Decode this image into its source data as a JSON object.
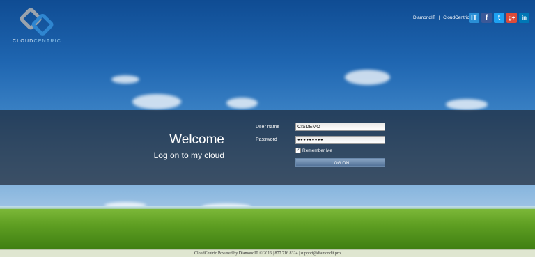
{
  "brand": {
    "logo_text_part1": "CLOUD",
    "logo_text_part2": "CENTRIC"
  },
  "header": {
    "links": [
      "DiamondIT",
      "|",
      "CloudCentric"
    ],
    "socials": [
      {
        "name": "it",
        "glyph": "IT",
        "color": "#2a8fd6"
      },
      {
        "name": "facebook",
        "glyph": "f",
        "color": "#3b5998"
      },
      {
        "name": "twitter",
        "glyph": "t",
        "color": "#1da1f2"
      },
      {
        "name": "google-plus",
        "glyph": "g+",
        "color": "#dd4b39"
      },
      {
        "name": "linkedin",
        "glyph": "in",
        "color": "#0077b5"
      }
    ]
  },
  "welcome": {
    "title": "Welcome",
    "subtitle": "Log on to my cloud"
  },
  "login": {
    "username_label": "User name",
    "username_value": "CISDEMO",
    "password_label": "Password",
    "password_value": "●●●●●●●●●",
    "remember_label": "Remember Me",
    "remember_checked": true,
    "logon_label": "LOG ON"
  },
  "footer": {
    "text": "CloudCentric Powered by DiamondIT © 2016 | 877.716.8324 | support@diamondit.pro"
  }
}
